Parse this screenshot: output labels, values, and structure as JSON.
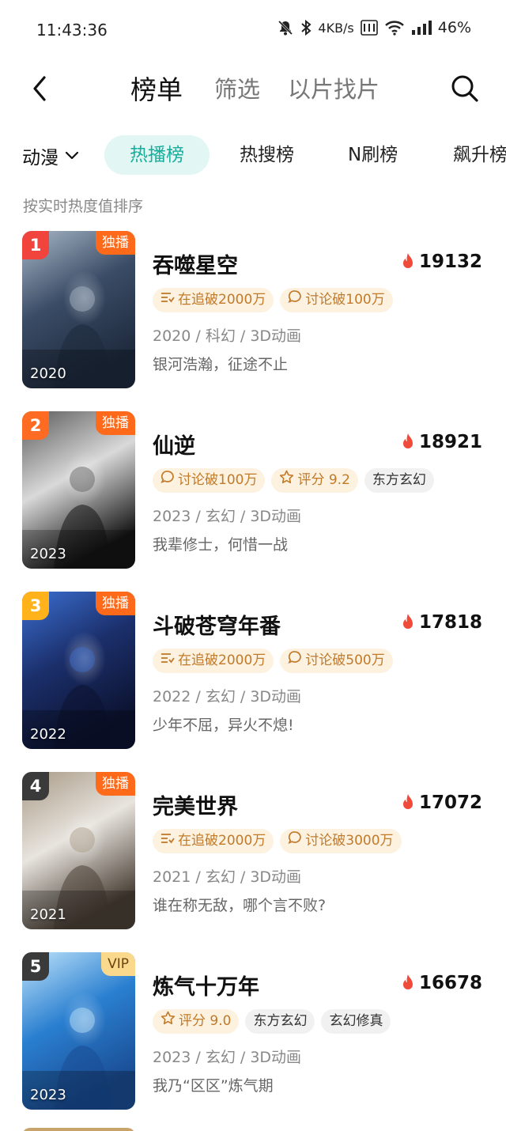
{
  "status": {
    "time": "11:43:36",
    "speed": "4KB/s",
    "battery": "46%"
  },
  "nav": {
    "tabs": [
      "榜单",
      "筛选",
      "以片找片"
    ]
  },
  "filter": {
    "category": "动漫",
    "chips": [
      "热播榜",
      "热搜榜",
      "N刷榜",
      "飙升榜"
    ]
  },
  "sort_hint": "按实时热度值排序",
  "items": [
    {
      "rank": "1",
      "rank_color": "#f0443c",
      "badge": "独播",
      "badge_type": "exclusive",
      "poster_year": "2020",
      "title": "吞噬星空",
      "hot": "19132",
      "tags": [
        {
          "icon": "list",
          "text": "在追破2000万",
          "style": "warm"
        },
        {
          "icon": "chat",
          "text": "讨论破100万",
          "style": "warm"
        }
      ],
      "meta": "2020 / 科幻 / 3D动画",
      "desc": "银河浩瀚，征途不止",
      "art": [
        "#3a4c66",
        "#a9b8c8",
        "#1e2a3d"
      ]
    },
    {
      "rank": "2",
      "rank_color": "#ff6b22",
      "badge": "独播",
      "badge_type": "exclusive",
      "poster_year": "2023",
      "title": "仙逆",
      "hot": "18921",
      "tags": [
        {
          "icon": "chat",
          "text": "讨论破100万",
          "style": "warm"
        },
        {
          "icon": "star",
          "text": "评分 9.2",
          "style": "warm"
        },
        {
          "icon": "",
          "text": "东方玄幻",
          "style": "gray"
        }
      ],
      "meta": "2023 / 玄幻 / 3D动画",
      "desc": "我辈修士，何惜一战",
      "art": [
        "#d9d9d9",
        "#5a5a5a",
        "#141414"
      ]
    },
    {
      "rank": "3",
      "rank_color": "#ffb21a",
      "badge": "独播",
      "badge_type": "exclusive",
      "poster_year": "2022",
      "title": "斗破苍穹年番",
      "hot": "17818",
      "tags": [
        {
          "icon": "list",
          "text": "在追破2000万",
          "style": "warm"
        },
        {
          "icon": "chat",
          "text": "讨论破500万",
          "style": "warm"
        }
      ],
      "meta": "2022 / 玄幻 / 3D动画",
      "desc": "少年不屈，异火不熄!",
      "art": [
        "#1b2f6b",
        "#3b6fd1",
        "#0c1330"
      ]
    },
    {
      "rank": "4",
      "rank_color": "#3a3a3a",
      "badge": "独播",
      "badge_type": "exclusive",
      "poster_year": "2021",
      "title": "完美世界",
      "hot": "17072",
      "tags": [
        {
          "icon": "list",
          "text": "在追破2000万",
          "style": "warm"
        },
        {
          "icon": "chat",
          "text": "讨论破3000万",
          "style": "warm"
        }
      ],
      "meta": "2021 / 玄幻 / 3D动画",
      "desc": "谁在称无敌，哪个言不败?",
      "art": [
        "#e8e4de",
        "#a89a86",
        "#4a4036"
      ]
    },
    {
      "rank": "5",
      "rank_color": "#3a3a3a",
      "badge": "VIP",
      "badge_type": "vip",
      "poster_year": "2023",
      "title": "炼气十万年",
      "hot": "16678",
      "tags": [
        {
          "icon": "star",
          "text": "评分 9.0",
          "style": "warm"
        },
        {
          "icon": "",
          "text": "东方玄幻",
          "style": "gray"
        },
        {
          "icon": "",
          "text": "玄幻修真",
          "style": "gray"
        }
      ],
      "meta": "2023 / 玄幻 / 3D动画",
      "desc": "我乃“区区”炼气期",
      "art": [
        "#2a7fd0",
        "#bfe4fb",
        "#1a4d94"
      ]
    }
  ]
}
